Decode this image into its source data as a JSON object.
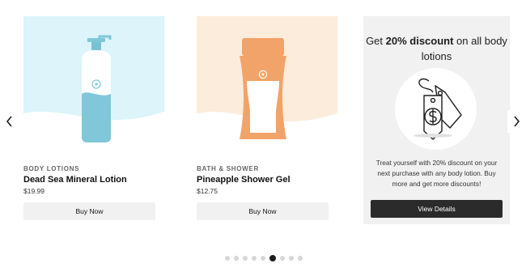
{
  "carousel": {
    "products": [
      {
        "category": "BODY LOTIONS",
        "name": "Dead Sea Mineral Lotion",
        "price": "$19.99",
        "button_label": "Buy Now",
        "image_bg": "#dcf4fa",
        "product_color": "#7fc7d9"
      },
      {
        "category": "BATH & SHOWER",
        "name": "Pineapple Shower Gel",
        "price": "$12.75",
        "button_label": "Buy Now",
        "image_bg": "#fcecdb",
        "product_color": "#f2a36a"
      }
    ],
    "promo": {
      "title_prefix": "Get ",
      "title_highlight": "20% discount",
      "title_suffix": " on all body lotions",
      "icon": "price-tag-dollar-icon",
      "description": "Treat yourself with 20% discount on your next purchase with any body lotion. Buy more and get more discounts!",
      "button_label": "View Details"
    },
    "navigation": {
      "prev_icon": "chevron-left-icon",
      "next_icon": "chevron-right-icon"
    },
    "pagination": {
      "total": 9,
      "active_index": 5
    }
  },
  "colors": {
    "accent_dark": "#2b2b2b",
    "button_light": "#f1f1f1",
    "promo_bg": "#f1f1f1"
  }
}
